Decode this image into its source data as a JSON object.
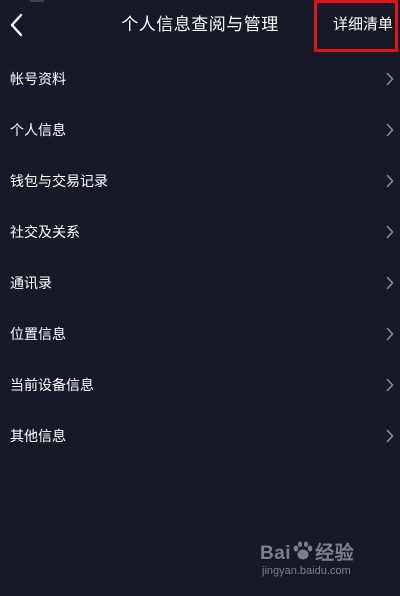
{
  "header": {
    "title": "个人信息查阅与管理",
    "detail_link": "详细清单"
  },
  "list": {
    "items": [
      {
        "label": "帐号资料"
      },
      {
        "label": "个人信息"
      },
      {
        "label": "钱包与交易记录"
      },
      {
        "label": "社交及关系"
      },
      {
        "label": "通讯录"
      },
      {
        "label": "位置信息"
      },
      {
        "label": "当前设备信息"
      },
      {
        "label": "其他信息"
      }
    ]
  },
  "watermark": {
    "brand_a": "Bai",
    "brand_b": "经验",
    "url": "jingyan.baidu.com"
  },
  "colors": {
    "background": "#161a27",
    "text": "#ffffff",
    "chevron": "#8a8f9c",
    "highlight": "#e0121c"
  }
}
